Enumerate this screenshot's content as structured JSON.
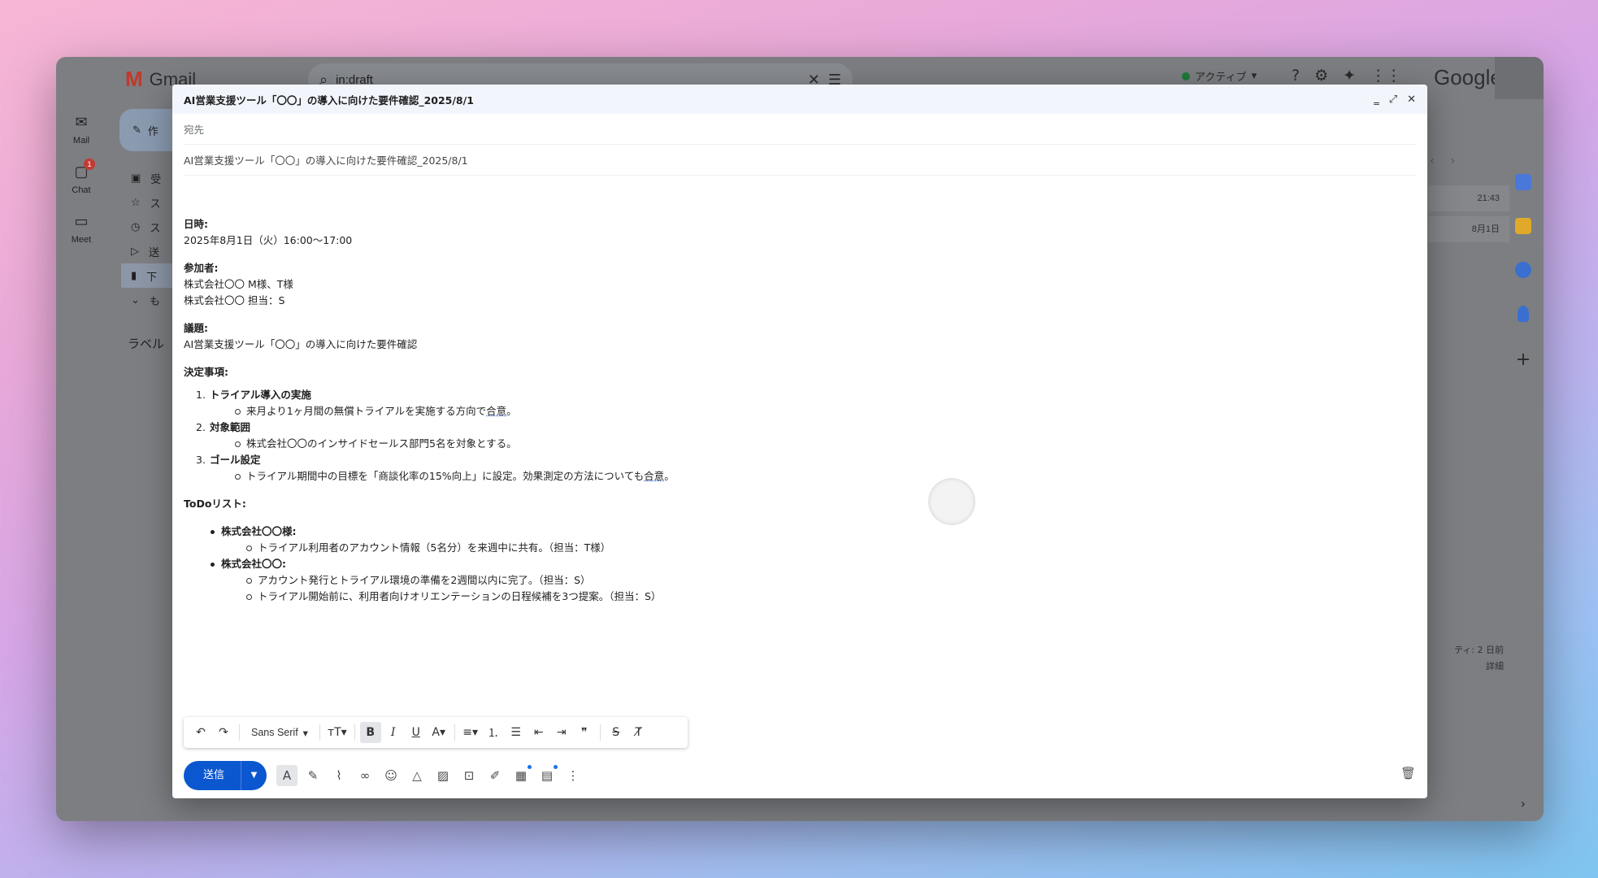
{
  "gmail": {
    "logo_text": "Gmail",
    "search_query": "in:draft",
    "status": "アクティブ",
    "google": "Google",
    "rail": [
      {
        "label": "Mail",
        "icon": "✉"
      },
      {
        "label": "Chat",
        "icon": "💬",
        "badge": "1"
      },
      {
        "label": "Meet",
        "icon": "▶"
      }
    ],
    "compose_label": "作",
    "sidebar_items": [
      "受",
      "ス",
      "ス",
      "送",
      "下",
      "も"
    ],
    "labels_heading": "ラベル",
    "mail_times": [
      "21:43",
      "8月1日"
    ],
    "activity": "ティ: 2 日前",
    "details": "詳細"
  },
  "compose": {
    "title": "AI営業支援ツール「〇〇」の導入に向けた要件確認_2025/8/1",
    "to_label": "宛先",
    "subject": "AI営業支援ツール「〇〇」の導入に向けた要件確認_2025/8/1",
    "date_heading": "日時:",
    "date_value": "2025年8月1日（火）16:00〜17:00",
    "participants_heading": "参加者:",
    "participants": [
      "株式会社〇〇 M様、T様",
      "株式会社〇〇 担当：S"
    ],
    "agenda_heading": "議題:",
    "agenda_value": "AI営業支援ツール「〇〇」の導入に向けた要件確認",
    "decisions_heading": "決定事項:",
    "decisions": [
      {
        "num": "1.",
        "title": "トライアル導入の実施",
        "detail_pre": "来月より1ヶ月間の無償トライアルを実施する方向で",
        "detail_u": "合意",
        "detail_post": "。"
      },
      {
        "num": "2.",
        "title": "対象範囲",
        "detail_pre": "株式会社〇〇のインサイドセールス部門5名を対象とする。",
        "detail_u": "",
        "detail_post": ""
      },
      {
        "num": "3.",
        "title": "ゴール設定",
        "detail_pre": "トライアル期間中の目標を「商談化率の15%向上」に設定。効果測定の方法についても",
        "detail_u": "合意",
        "detail_post": "。"
      }
    ],
    "todo_heading": "ToDoリスト:",
    "todos": [
      {
        "who": "株式会社〇〇様:",
        "items": [
          "トライアル利用者のアカウント情報（5名分）を来週中に共有。（担当：T様）"
        ]
      },
      {
        "who": "株式会社〇〇:",
        "items": [
          "アカウント発行とトライアル環境の準備を2週間以内に完了。（担当：S）",
          "トライアル開始前に、利用者向けオリエンテーションの日程候補を3つ提案。（担当：S）"
        ]
      }
    ],
    "font_name": "Sans Serif",
    "send_label": "送信"
  }
}
